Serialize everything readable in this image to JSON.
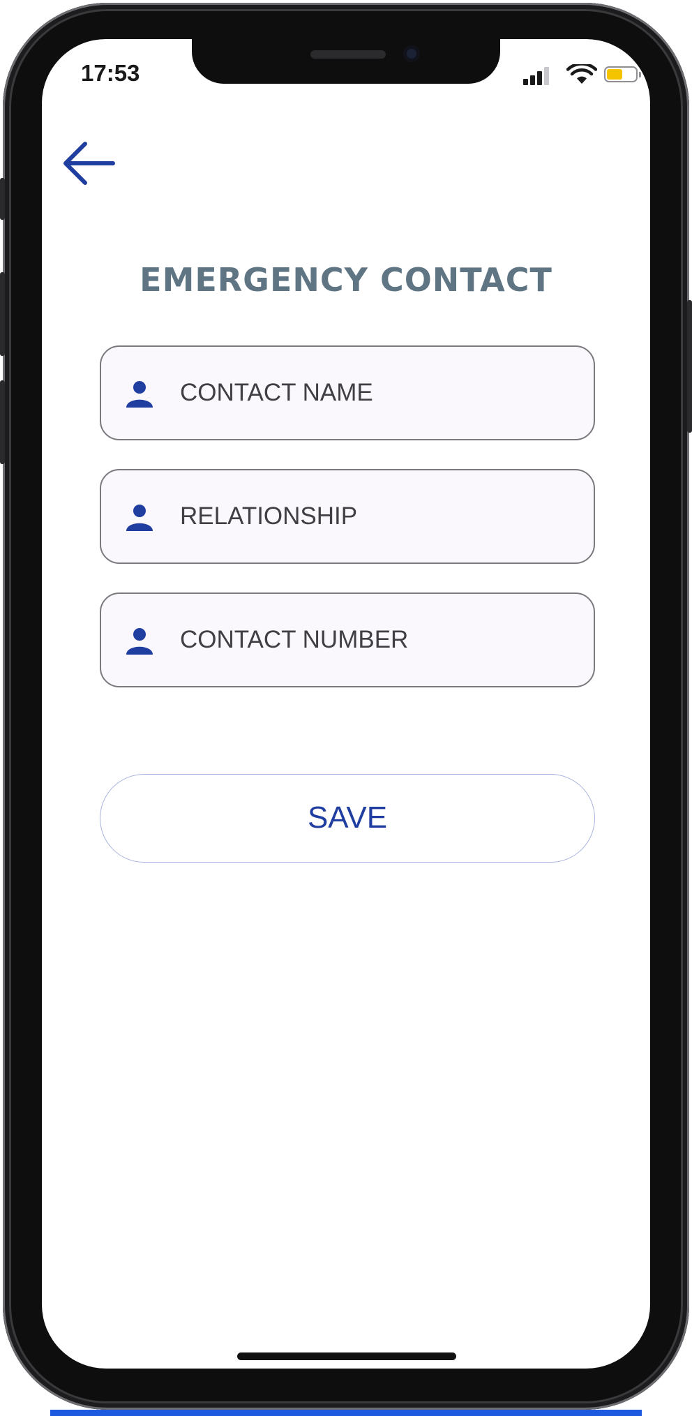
{
  "status_bar": {
    "time": "17:53",
    "battery_level": 0.55,
    "battery_color": "#f5c400"
  },
  "header": {
    "back_icon": "arrow-left-icon",
    "title": "EMERGENCY CONTACT"
  },
  "form": {
    "fields": [
      {
        "placeholder": "CONTACT NAME",
        "icon": "person-icon"
      },
      {
        "placeholder": "RELATIONSHIP",
        "icon": "person-icon"
      },
      {
        "placeholder": "CONTACT NUMBER",
        "icon": "person-icon"
      }
    ],
    "save_label": "SAVE"
  },
  "theme": {
    "accent": "#1f3ea0",
    "title_color": "#5f7584",
    "field_background": "#faf8fd"
  }
}
